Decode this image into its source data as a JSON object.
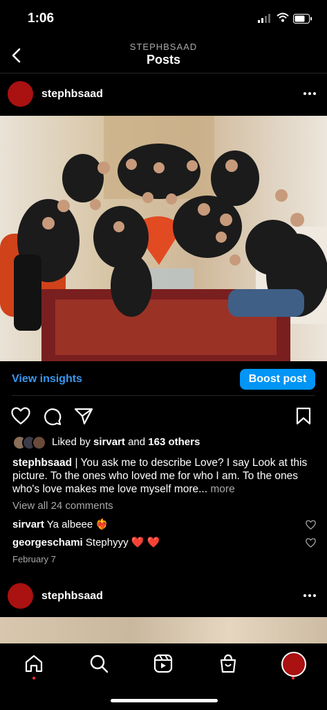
{
  "status_bar": {
    "time": "1:06"
  },
  "header": {
    "username": "STEPHBSAAD",
    "title": "Posts"
  },
  "post": {
    "username": "stephbsaad",
    "insights_label": "View insights",
    "boost_label": "Boost post",
    "liked_by_prefix": "Liked by",
    "liked_by_user": "sirvart",
    "liked_by_and": "and",
    "liked_by_others": "163 others",
    "caption_user": "stephbsaad",
    "caption_text": "| You ask me to describe Love? I say Look at this picture. To the ones who loved me for who I am. To the ones who's love makes me love myself more...",
    "caption_more": "more",
    "view_all_comments": "View all 24 comments",
    "comments": [
      {
        "user": "sirvart",
        "text": "Ya albeee",
        "emoji": "❤️‍🔥"
      },
      {
        "user": "georgeschami",
        "text": "Stephyyy",
        "emoji": "❤️ ❤️"
      }
    ],
    "date": "February 7"
  },
  "next_post": {
    "username": "stephbsaad"
  },
  "colors": {
    "accent": "#0095f6",
    "link": "#3897f0",
    "avatar": "#a11111",
    "notification": "#ff3040"
  },
  "icons": [
    "back-chevron-icon",
    "more-icon",
    "heart-icon",
    "comment-icon",
    "share-icon",
    "bookmark-icon",
    "home-icon",
    "search-icon",
    "reels-icon",
    "shop-icon",
    "profile-icon"
  ]
}
